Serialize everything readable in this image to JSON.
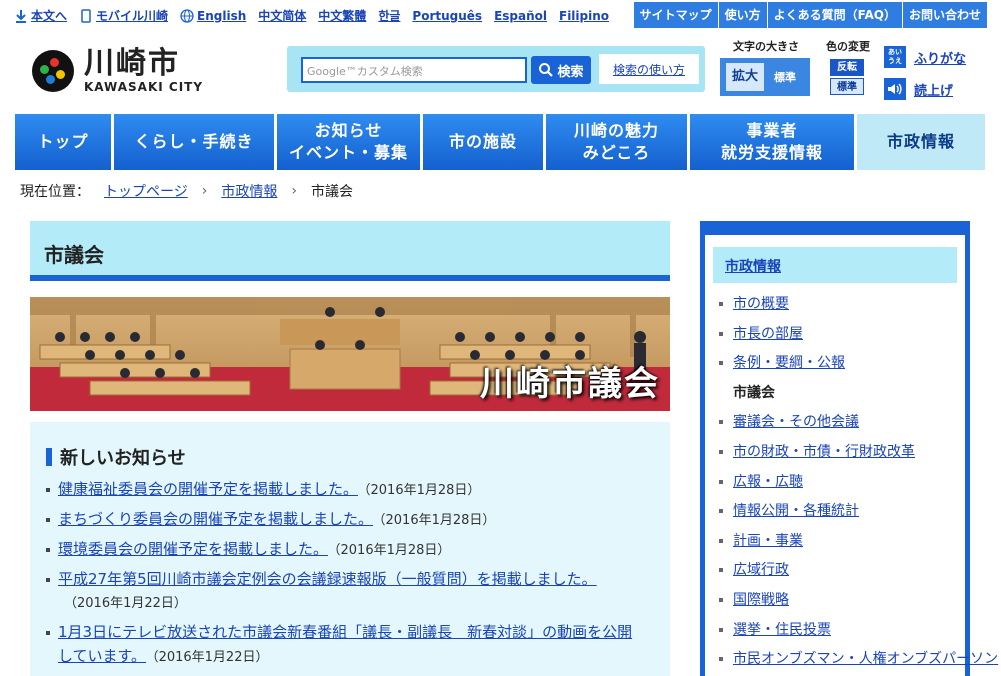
{
  "utility": {
    "left": [
      {
        "label": "本文へ",
        "icon": "download-icon"
      },
      {
        "label": "モバイル川崎",
        "icon": "mobile-icon"
      },
      {
        "label": "English",
        "icon": "globe-icon"
      },
      {
        "label": "中文简体"
      },
      {
        "label": "中文繁體"
      },
      {
        "label": "한글"
      },
      {
        "label": "Português"
      },
      {
        "label": "Español"
      },
      {
        "label": "Filipino"
      }
    ],
    "right": [
      "サイトマップ",
      "使い方",
      "よくある質問（FAQ）",
      "お問い合わせ"
    ]
  },
  "logo": {
    "jp": "川崎市",
    "en": "KAWASAKI CITY"
  },
  "search": {
    "placeholder": "Google™カスタム検索",
    "button": "検索",
    "help": "検索の使い方"
  },
  "text_size": {
    "label": "文字の大きさ",
    "larger": "拡大",
    "standard": "標準"
  },
  "color_change": {
    "label": "色の変更",
    "invert": "反転",
    "standard": "標準"
  },
  "tools": {
    "ruby_icon": "あい うえ",
    "ruby": "ふりがな",
    "read": "読上げ"
  },
  "nav": [
    {
      "line1": "トップ",
      "line2": ""
    },
    {
      "line1": "くらし・手続き",
      "line2": ""
    },
    {
      "line1": "お知らせ",
      "line2": "イベント・募集"
    },
    {
      "line1": "市の施設",
      "line2": ""
    },
    {
      "line1": "川崎の魅力",
      "line2": "みどころ"
    },
    {
      "line1": "事業者",
      "line2": "就労支援情報"
    },
    {
      "line1": "市政情報",
      "line2": ""
    }
  ],
  "breadcrumb": {
    "label": "現在位置：",
    "items": [
      "トップページ",
      "市政情報"
    ],
    "current": "市議会"
  },
  "page_title": "市議会",
  "banner_text": "川崎市議会",
  "news": {
    "heading": "新しいお知らせ",
    "items": [
      {
        "text": "健康福祉委員会の開催予定を掲載しました。",
        "date": "（2016年1月28日）"
      },
      {
        "text": "まちづくり委員会の開催予定を掲載しました。",
        "date": "（2016年1月28日）"
      },
      {
        "text": "環境委員会の開催予定を掲載しました。",
        "date": "（2016年1月28日）"
      },
      {
        "text": "平成27年第5回川崎市議会定例会の会議録速報版（一般質問）を掲載しました。",
        "date": "（2016年1月22日）"
      },
      {
        "text": "1月3日にテレビ放送された市議会新春番組「議長・副議長　新春対談」の動画を公開しています。",
        "date": "（2016年1月22日）"
      }
    ]
  },
  "sidebar": {
    "heading": "市政情報",
    "items": [
      "市の概要",
      "市長の部屋",
      "条例・要綱・公報",
      "市議会",
      "審議会・その他会議",
      "市の財政・市債・行財政改革",
      "広報・広聴",
      "情報公開・各種統計",
      "計画・事業",
      "広域行政",
      "国際戦略",
      "選挙・住民投票",
      "市民オンブズマン・人権オンブズパーソン"
    ],
    "current_index": 3
  }
}
